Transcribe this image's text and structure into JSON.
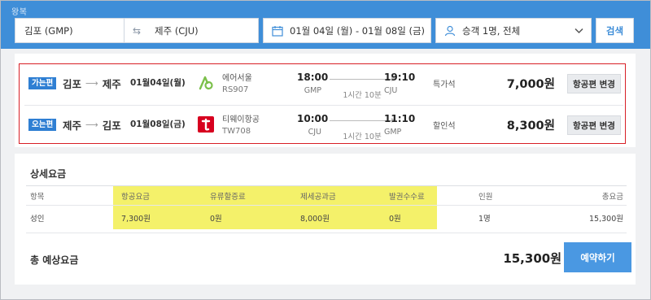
{
  "search": {
    "trip_type": "왕복",
    "origin": "김포 (GMP)",
    "destination": "제주 (CJU)",
    "dates": "01월 04일 (월) - 01월 08일 (금)",
    "passengers": "승객 1명, 전체",
    "search_button": "검색"
  },
  "itinerary": {
    "legs": [
      {
        "tag": "가는편",
        "from": "김포",
        "to": "제주",
        "date": "01월04일(월)",
        "airline": "에어서울",
        "flight_no": "RS907",
        "dep_time": "18:00",
        "dep_code": "GMP",
        "duration": "1시간 10분",
        "arr_time": "19:10",
        "arr_code": "CJU",
        "seat_class": "특가석",
        "price": "7,000원",
        "change_label": "항공편 변경",
        "logo_color": "#7cc04b"
      },
      {
        "tag": "오는편",
        "from": "제주",
        "to": "김포",
        "date": "01월08일(금)",
        "airline": "티웨이항공",
        "flight_no": "TW708",
        "dep_time": "10:00",
        "dep_code": "CJU",
        "duration": "1시간 10분",
        "arr_time": "11:10",
        "arr_code": "GMP",
        "seat_class": "할인석",
        "price": "8,300원",
        "change_label": "항공편 변경",
        "logo_color": "#d7001f"
      }
    ]
  },
  "fare": {
    "title": "상세요금",
    "headers": [
      "항목",
      "항공요금",
      "유류할증료",
      "제세공과금",
      "발권수수료",
      "인원",
      "총요금"
    ],
    "rows": [
      [
        "성인",
        "7,300원",
        "0원",
        "8,000원",
        "0원",
        "1명",
        "15,300원"
      ]
    ],
    "highlight_color": "#f4f16a"
  },
  "total": {
    "label": "총 예상요금",
    "price": "15,300원",
    "reserve_button": "예약하기"
  },
  "colors": {
    "header_blue": "#3f8ed8",
    "tag_blue": "#2f7fd3",
    "highlight_red": "#d81f26",
    "button_blue": "#4a98e2"
  }
}
